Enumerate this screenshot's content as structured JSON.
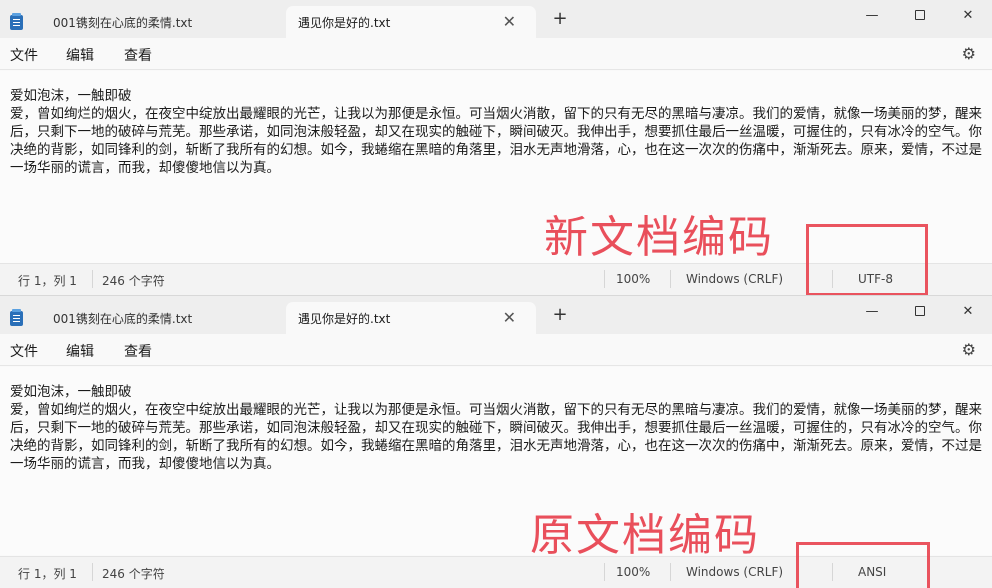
{
  "top_window": {
    "tabs": [
      {
        "label": "001镌刻在心底的柔情.txt"
      },
      {
        "label": "遇见你是好的.txt"
      }
    ],
    "window_controls": {
      "minimize": "—",
      "close": "✕"
    },
    "menu": [
      "文件",
      "编辑",
      "查看"
    ],
    "content": {
      "line1": "爱如泡沫，一触即破",
      "line2": "爱，曾如绚烂的烟火，在夜空中绽放出最耀眼的光芒，让我以为那便是永恒。可当烟火消散，留下的只有无尽的黑暗与凄凉。我们的爱情，就像一场美丽的梦，醒来后，只剩下一地的破碎与荒芜。那些承诺，如同泡沫般轻盈，却又在现实的触碰下，瞬间破灭。我伸出手，想要抓住最后一丝温暖，可握住的，只有冰冷的空气。你决绝的背影，如同锋利的剑，斩断了我所有的幻想。如今，我蜷缩在黑暗的角落里，泪水无声地滑落，心，也在这一次次的伤痛中，渐渐死去。原来，爱情，不过是一场华丽的谎言，而我，却傻傻地信以为真。"
    },
    "status": {
      "position": "行 1，列 1",
      "chars": "246 个字符",
      "zoom": "100%",
      "line_ending": "Windows (CRLF)",
      "encoding": "UTF-8"
    },
    "annotation": "新文档编码"
  },
  "bottom_window": {
    "tabs": [
      {
        "label": "001镌刻在心底的柔情.txt"
      },
      {
        "label": "遇见你是好的.txt"
      }
    ],
    "window_controls": {
      "minimize": "—",
      "close": "✕"
    },
    "menu": [
      "文件",
      "编辑",
      "查看"
    ],
    "content": {
      "line1": "爱如泡沫，一触即破",
      "line2": "爱，曾如绚烂的烟火，在夜空中绽放出最耀眼的光芒，让我以为那便是永恒。可当烟火消散，留下的只有无尽的黑暗与凄凉。我们的爱情，就像一场美丽的梦，醒来后，只剩下一地的破碎与荒芜。那些承诺，如同泡沫般轻盈，却又在现实的触碰下，瞬间破灭。我伸出手，想要抓住最后一丝温暖，可握住的，只有冰冷的空气。你决绝的背影，如同锋利的剑，斩断了我所有的幻想。如今，我蜷缩在黑暗的角落里，泪水无声地滑落，心，也在这一次次的伤痛中，渐渐死去。原来，爱情，不过是一场华丽的谎言，而我，却傻傻地信以为真。"
    },
    "status": {
      "position": "行 1，列 1",
      "chars": "246 个字符",
      "zoom": "100%",
      "line_ending": "Windows (CRLF)",
      "encoding": "ANSI"
    },
    "annotation": "原文档编码"
  },
  "icons": {
    "tab_close": "✕",
    "new_tab": "+",
    "settings": "⚙"
  },
  "colors": {
    "annotation": "#e8414e",
    "notepad_icon": "#2a6fb8"
  }
}
